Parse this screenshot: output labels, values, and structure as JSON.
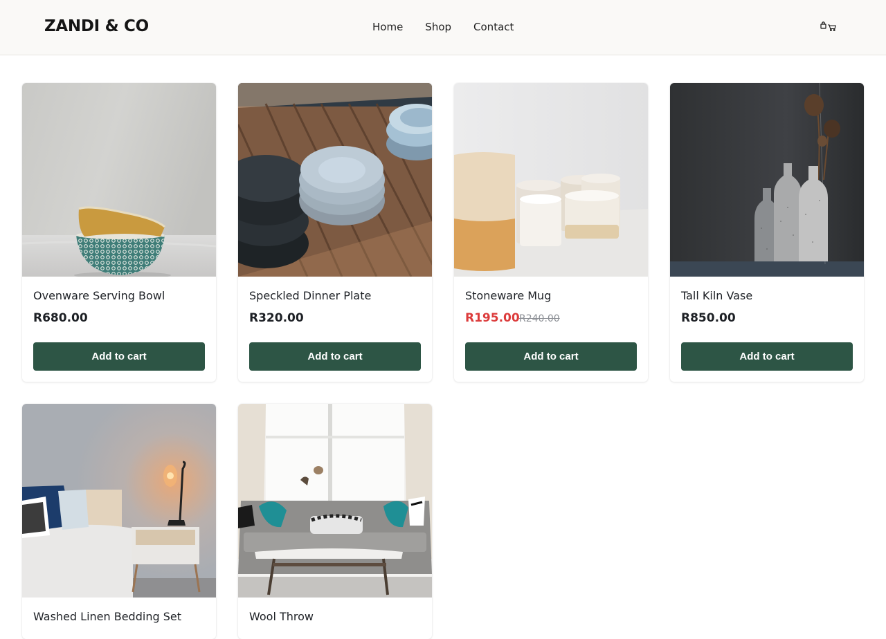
{
  "brand": {
    "logo": "ZANDI & CO"
  },
  "nav": {
    "home": "Home",
    "shop": "Shop",
    "contact": "Contact"
  },
  "header_icons": [
    "bag-icon",
    "cart-icon"
  ],
  "colors": {
    "accent": "#2d5545",
    "sale": "#dc3b3b",
    "header_bg": "#faf9f7"
  },
  "products": [
    {
      "name": "Ovenware Serving Bowl",
      "price": "R680.00",
      "button": "Add to cart"
    },
    {
      "name": "Speckled Dinner Plate",
      "price": "R320.00",
      "button": "Add to cart"
    },
    {
      "name": "Stoneware Mug",
      "price": "R195.00",
      "old_price": "R240.00",
      "button": "Add to cart"
    },
    {
      "name": "Tall Kiln Vase",
      "price": "R850.00",
      "button": "Add to cart"
    },
    {
      "name": "Washed Linen Bedding Set"
    },
    {
      "name": "Wool Throw"
    }
  ]
}
